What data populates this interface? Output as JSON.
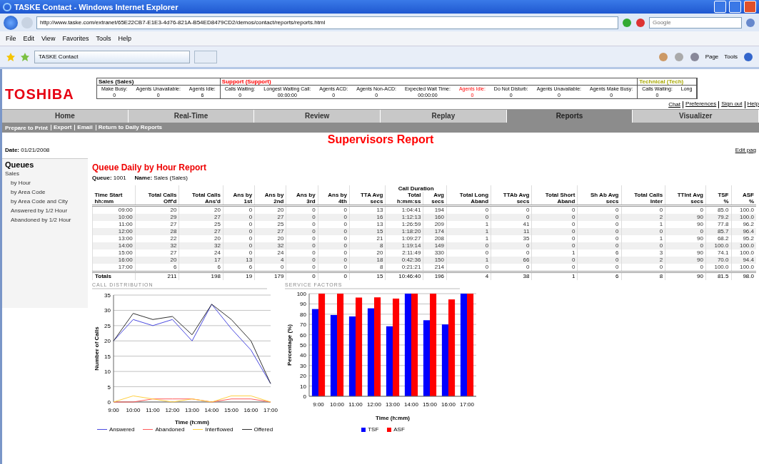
{
  "window": {
    "title": "TASKE Contact - Windows Internet Explorer"
  },
  "address_bar": {
    "url": "http://www.taske.com/extranet/65E22CB7-E1E3-4d76-821A-B54ED8479CD2/demos/contact/reports/reports.html",
    "search_placeholder": "Google"
  },
  "menu": [
    "File",
    "Edit",
    "View",
    "Favorites",
    "Tools",
    "Help"
  ],
  "browser_tab": {
    "label": "TASKE Contact"
  },
  "command_bar": [
    "Page",
    "Tools"
  ],
  "logo": "TOSHIBA",
  "status_groups": [
    {
      "name": "Sales (Sales)",
      "color": "#000000",
      "fields": [
        {
          "label": "Make Busy:",
          "value": "0",
          "alert": false
        },
        {
          "label": "Agents Unavailable:",
          "value": "0",
          "alert": false
        },
        {
          "label": "Agents Idle:",
          "value": "6",
          "alert": false
        }
      ]
    },
    {
      "name": "Support (Support)",
      "color": "#ff0000",
      "fields": [
        {
          "label": "Calls Waiting:",
          "value": "0",
          "alert": false
        },
        {
          "label": "Longest Waiting Call:",
          "value": "00:00:00",
          "alert": false
        },
        {
          "label": "Agents ACD:",
          "value": "0",
          "alert": false
        },
        {
          "label": "Agents Non-ACD:",
          "value": "0",
          "alert": false
        },
        {
          "label": "Expected Wait Time:",
          "value": "00:00:00",
          "alert": false
        },
        {
          "label": "Agents Idle:",
          "value": "0",
          "alert": true
        },
        {
          "label": "Do Not Disturb:",
          "value": "0",
          "alert": false
        },
        {
          "label": "Agents Unavailable:",
          "value": "0",
          "alert": false
        },
        {
          "label": "Agents Make Busy:",
          "value": "0",
          "alert": false
        }
      ]
    },
    {
      "name": "Technical (Tech)",
      "color": "#a8a800",
      "fields": [
        {
          "label": "Calls Waiting:",
          "value": "0",
          "alert": false
        },
        {
          "label": "Long",
          "alert": false
        }
      ]
    }
  ],
  "user_links": [
    "Chat",
    "Preferences",
    "Sign out",
    "Help"
  ],
  "tabs": [
    {
      "label": "Home",
      "selected": false
    },
    {
      "label": "Real-Time",
      "selected": false
    },
    {
      "label": "Review",
      "selected": false
    },
    {
      "label": "Replay",
      "selected": false
    },
    {
      "label": "Reports",
      "selected": true
    },
    {
      "label": "Visualizer",
      "selected": false
    }
  ],
  "actions": [
    "Prepare to Print",
    "Export",
    "Email",
    "Return to Daily Reports"
  ],
  "page_title": "Supervisors Report",
  "date": {
    "label": "Date:",
    "value": "01/21/2008"
  },
  "edit_link": "Edit pag",
  "sidebar": {
    "title": "Queues",
    "items": [
      {
        "label": "Sales",
        "children": [
          {
            "label": "by Hour"
          },
          {
            "label": "by Area Code"
          },
          {
            "label": "by Area Code and City"
          },
          {
            "label": "Answered by 1/2 Hour"
          },
          {
            "label": "Abandoned by 1/2 Hour"
          }
        ]
      }
    ]
  },
  "report": {
    "title": "Queue Daily by Hour Report",
    "queue": {
      "label": "Queue:",
      "value": "1001"
    },
    "name": {
      "label": "Name:",
      "value": "Sales (Sales)"
    },
    "table": {
      "column_groups": [
        {
          "label": "Call Duration",
          "colspan": 2
        }
      ],
      "columns": [
        {
          "lines": [
            "Time Start",
            "hh:mm"
          ]
        },
        {
          "lines": [
            "Total Calls",
            "Off'd"
          ]
        },
        {
          "lines": [
            "Total Calls",
            "Ans'd"
          ]
        },
        {
          "lines": [
            "Ans by",
            "1st"
          ]
        },
        {
          "lines": [
            "Ans by",
            "2nd"
          ]
        },
        {
          "lines": [
            "Ans by",
            "3rd"
          ]
        },
        {
          "lines": [
            "Ans by",
            "4th"
          ]
        },
        {
          "lines": [
            "TTA Avg",
            "secs"
          ]
        },
        {
          "lines": [
            "Total",
            "h:mm:ss"
          ],
          "in_group": true
        },
        {
          "lines": [
            "Avg",
            "secs"
          ],
          "in_group": true
        },
        {
          "lines": [
            "Total Long",
            "Aband"
          ]
        },
        {
          "lines": [
            "TTAb Avg",
            "secs"
          ]
        },
        {
          "lines": [
            "Total Short",
            "Aband"
          ]
        },
        {
          "lines": [
            "Sh Ab Avg",
            "secs"
          ]
        },
        {
          "lines": [
            "Total Calls",
            "Inter"
          ]
        },
        {
          "lines": [
            "TTInt Avg",
            "secs"
          ]
        },
        {
          "lines": [
            "TSF",
            "%"
          ]
        },
        {
          "lines": [
            "ASF",
            "%"
          ]
        }
      ],
      "rows": [
        [
          "09:00",
          "20",
          "20",
          "0",
          "20",
          "0",
          "0",
          "13",
          "1:04:41",
          "194",
          "0",
          "0",
          "0",
          "0",
          "0",
          "0",
          "85.0",
          "100.0"
        ],
        [
          "10:00",
          "29",
          "27",
          "0",
          "27",
          "0",
          "0",
          "16",
          "1:12:13",
          "160",
          "0",
          "0",
          "0",
          "0",
          "2",
          "90",
          "79.2",
          "100.0"
        ],
        [
          "11:00",
          "27",
          "25",
          "0",
          "25",
          "0",
          "0",
          "13",
          "1:26:59",
          "209",
          "1",
          "41",
          "0",
          "0",
          "1",
          "90",
          "77.8",
          "96.2"
        ],
        [
          "12:00",
          "28",
          "27",
          "0",
          "27",
          "0",
          "0",
          "15",
          "1:18:20",
          "174",
          "1",
          "11",
          "0",
          "0",
          "0",
          "0",
          "85.7",
          "96.4"
        ],
        [
          "13:00",
          "22",
          "20",
          "0",
          "20",
          "0",
          "0",
          "21",
          "1:09:27",
          "208",
          "1",
          "35",
          "0",
          "0",
          "1",
          "90",
          "68.2",
          "95.2"
        ],
        [
          "14:00",
          "32",
          "32",
          "0",
          "32",
          "0",
          "0",
          "8",
          "1:19:14",
          "149",
          "0",
          "0",
          "0",
          "0",
          "0",
          "0",
          "100.0",
          "100.0"
        ],
        [
          "15:00",
          "27",
          "24",
          "0",
          "24",
          "0",
          "0",
          "20",
          "2:11:49",
          "330",
          "0",
          "0",
          "1",
          "6",
          "3",
          "90",
          "74.1",
          "100.0"
        ],
        [
          "16:00",
          "20",
          "17",
          "13",
          "4",
          "0",
          "0",
          "18",
          "0:42:36",
          "150",
          "1",
          "66",
          "0",
          "0",
          "2",
          "90",
          "70.0",
          "94.4"
        ],
        [
          "17:00",
          "6",
          "6",
          "6",
          "0",
          "0",
          "0",
          "8",
          "0:21:21",
          "214",
          "0",
          "0",
          "0",
          "0",
          "0",
          "0",
          "100.0",
          "100.0"
        ]
      ],
      "totals": [
        "Totals",
        "211",
        "198",
        "19",
        "179",
        "0",
        "0",
        "15",
        "10:46:40",
        "196",
        "4",
        "38",
        "1",
        "6",
        "8",
        "90",
        "81.5",
        "98.0"
      ]
    }
  },
  "charts": [
    {
      "title": "CALL DISTRIBUTION",
      "chart_data": {
        "type": "line",
        "grid": true,
        "xlabel": "Time (h:mm)",
        "ylabel": "Number of Calls",
        "categories": [
          "9:00",
          "10:00",
          "11:00",
          "12:00",
          "13:00",
          "14:00",
          "15:00",
          "16:00",
          "17:00"
        ],
        "ylim": [
          0,
          35
        ],
        "yticks": [
          0,
          5,
          10,
          15,
          20,
          25,
          30,
          35
        ],
        "series": [
          {
            "name": "Answered",
            "color": "#4a4ae0",
            "values": [
              20,
              27,
              25,
              27,
              20,
              32,
              24,
              17,
              6
            ]
          },
          {
            "name": "Abandoned",
            "color": "#ff5a5a",
            "values": [
              0,
              0,
              1,
              1,
              1,
              0,
              1,
              1,
              0
            ]
          },
          {
            "name": "Interflowed",
            "color": "#ffd040",
            "values": [
              0,
              2,
              1,
              0,
              1,
              0,
              2,
              2,
              0
            ]
          },
          {
            "name": "Offered",
            "color": "#303030",
            "values": [
              20,
              29,
              27,
              28,
              22,
              32,
              27,
              20,
              6
            ]
          }
        ]
      }
    },
    {
      "title": "SERVICE FACTORS",
      "chart_data": {
        "type": "bar",
        "grid": true,
        "xlabel": "Time (h:mm)",
        "ylabel": "Percentage (%)",
        "categories": [
          "9:00",
          "10:00",
          "11:00",
          "12:00",
          "13:00",
          "14:00",
          "15:00",
          "16:00",
          "17:00"
        ],
        "ylim": [
          0,
          100
        ],
        "yticks": [
          0,
          10,
          20,
          30,
          40,
          50,
          60,
          70,
          80,
          90,
          100
        ],
        "series": [
          {
            "name": "TSF",
            "color": "#0000ff",
            "values": [
              85.0,
              79.2,
              77.8,
              85.7,
              68.2,
              100.0,
              74.1,
              70.0,
              100.0
            ]
          },
          {
            "name": "ASF",
            "color": "#ff0000",
            "values": [
              100.0,
              100.0,
              96.2,
              96.4,
              95.2,
              100.0,
              100.0,
              94.4,
              100.0
            ]
          }
        ]
      }
    }
  ]
}
